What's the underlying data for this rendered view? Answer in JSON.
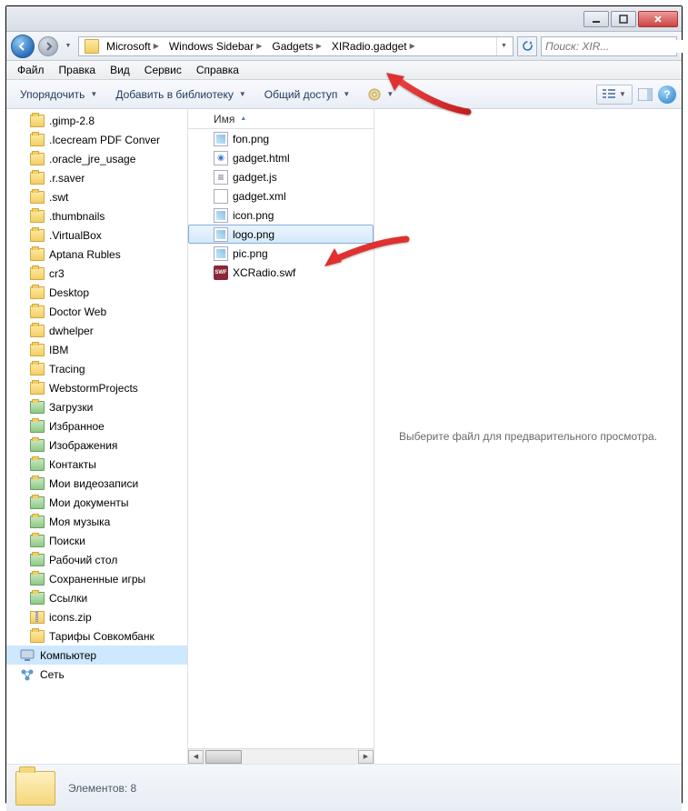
{
  "titlebar": {
    "min": "minimize",
    "max": "maximize",
    "close": "close"
  },
  "breadcrumbs": [
    "Microsoft",
    "Windows Sidebar",
    "Gadgets",
    "XIRadio.gadget"
  ],
  "search": {
    "placeholder": "Поиск: XIR..."
  },
  "menu": {
    "file": "Файл",
    "edit": "Правка",
    "view": "Вид",
    "service": "Сервис",
    "help": "Справка"
  },
  "toolbar": {
    "organize": "Упорядочить",
    "add_library": "Добавить в библиотеку",
    "share": "Общий доступ"
  },
  "columns": {
    "name": "Имя"
  },
  "sidebar": {
    "items": [
      {
        "label": ".gimp-2.8",
        "icon": "folder"
      },
      {
        "label": ".Icecream PDF Conver",
        "icon": "folder"
      },
      {
        "label": ".oracle_jre_usage",
        "icon": "folder"
      },
      {
        "label": ".r.saver",
        "icon": "folder"
      },
      {
        "label": ".swt",
        "icon": "folder"
      },
      {
        "label": ".thumbnails",
        "icon": "folder"
      },
      {
        "label": ".VirtualBox",
        "icon": "folder"
      },
      {
        "label": "Aptana Rubles",
        "icon": "folder"
      },
      {
        "label": "cr3",
        "icon": "folder"
      },
      {
        "label": "Desktop",
        "icon": "folder"
      },
      {
        "label": "Doctor Web",
        "icon": "folder"
      },
      {
        "label": "dwhelper",
        "icon": "folder"
      },
      {
        "label": "IBM",
        "icon": "folder"
      },
      {
        "label": "Tracing",
        "icon": "folder"
      },
      {
        "label": "WebstormProjects",
        "icon": "folder"
      },
      {
        "label": "Загрузки",
        "icon": "special"
      },
      {
        "label": "Избранное",
        "icon": "special"
      },
      {
        "label": "Изображения",
        "icon": "special"
      },
      {
        "label": "Контакты",
        "icon": "special"
      },
      {
        "label": "Мои видеозаписи",
        "icon": "special"
      },
      {
        "label": "Мои документы",
        "icon": "special"
      },
      {
        "label": "Моя музыка",
        "icon": "special"
      },
      {
        "label": "Поиски",
        "icon": "special"
      },
      {
        "label": "Рабочий стол",
        "icon": "special"
      },
      {
        "label": "Сохраненные игры",
        "icon": "special"
      },
      {
        "label": "Ссылки",
        "icon": "special"
      },
      {
        "label": "icons.zip",
        "icon": "zip"
      },
      {
        "label": "Тарифы Совкомбанк",
        "icon": "folder"
      }
    ],
    "computer": "Компьютер",
    "network": "Сеть"
  },
  "files": [
    {
      "name": "fon.png",
      "type": "png"
    },
    {
      "name": "gadget.html",
      "type": "html"
    },
    {
      "name": "gadget.js",
      "type": "js"
    },
    {
      "name": "gadget.xml",
      "type": "xml"
    },
    {
      "name": "icon.png",
      "type": "png"
    },
    {
      "name": "logo.png",
      "type": "png",
      "selected": true
    },
    {
      "name": "pic.png",
      "type": "png"
    },
    {
      "name": "XCRadio.swf",
      "type": "swf",
      "swf_label": "SWF"
    }
  ],
  "preview": {
    "empty": "Выберите файл для предварительного просмотра."
  },
  "details": {
    "count_label": "Элементов: 8"
  }
}
